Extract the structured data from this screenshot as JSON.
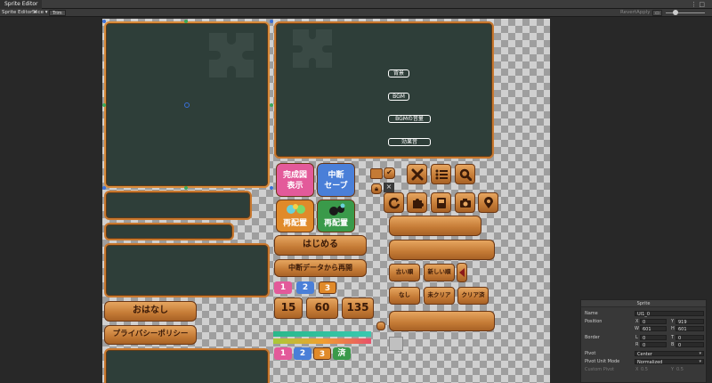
{
  "window": {
    "tab_title": "Sprite Editor",
    "menu_glyph": "⋮ □"
  },
  "toolbar": {
    "sprite_editor_dropdown": "Sprite Editor ▾",
    "slice_dropdown": "Slice ▾",
    "trim_button": "Trim",
    "revert_button": "Revert",
    "apply_button": "Apply",
    "zoom_icon": "▭"
  },
  "sprite": {
    "settings_panel_labels": [
      "背景",
      "BGM",
      "BGMの音量",
      "効果音"
    ],
    "buttons": {
      "show_complete": "完成図\n表示",
      "suspend_save": "中断\nセーブ",
      "rearrange_1": "再配置",
      "rearrange_2": "再配置",
      "start": "はじめる",
      "resume": "中断データから再開",
      "story": "おはなし",
      "privacy": "プライバシーポリシー",
      "old_order": "古い順",
      "new_order": "新しい順",
      "none": "なし",
      "uncleared": "未クリア",
      "cleared": "クリア済"
    },
    "num_tabs_top": [
      "1",
      "2",
      "3"
    ],
    "num_tabs_bottom": [
      "1",
      "2",
      "3",
      "済"
    ],
    "piece_counts": [
      "15",
      "60",
      "135"
    ],
    "icon_names": [
      "close-x-icon",
      "list-icon",
      "search-icon",
      "reload-icon",
      "puzzle-icon",
      "album-icon",
      "camera-icon",
      "map-pin-icon"
    ]
  },
  "inspector": {
    "header": "Sprite",
    "rows": [
      {
        "label": "Name",
        "fields": [
          {
            "k": "",
            "v": "UI1_0"
          }
        ]
      },
      {
        "label": "Position",
        "fields": [
          {
            "k": "X",
            "v": "0"
          },
          {
            "k": "Y",
            "v": "919"
          }
        ]
      },
      {
        "label": "",
        "fields": [
          {
            "k": "W",
            "v": "601"
          },
          {
            "k": "H",
            "v": "601"
          }
        ]
      },
      {
        "label": "Border",
        "fields": [
          {
            "k": "L",
            "v": "0"
          },
          {
            "k": "T",
            "v": "0"
          }
        ]
      },
      {
        "label": "",
        "fields": [
          {
            "k": "R",
            "v": "0"
          },
          {
            "k": "B",
            "v": "0"
          }
        ]
      },
      {
        "label": "Pivot",
        "fields": [
          {
            "k": "",
            "v": "Center"
          }
        ]
      },
      {
        "label": "Pivot Unit Mode",
        "fields": [
          {
            "k": "",
            "v": "Normalized"
          }
        ]
      },
      {
        "label": "Custom Pivot",
        "fields": [
          {
            "k": "X",
            "v": "0.5"
          },
          {
            "k": "Y",
            "v": "0.5"
          }
        ]
      }
    ]
  },
  "colors": {
    "accent_selection": "#3a6fd8",
    "wood": "#c47a35",
    "panel": "#2e3e39",
    "pink": "#e35a9a",
    "blue": "#4a7fd8",
    "orange": "#e08a2a",
    "green": "#3a9a4a"
  }
}
